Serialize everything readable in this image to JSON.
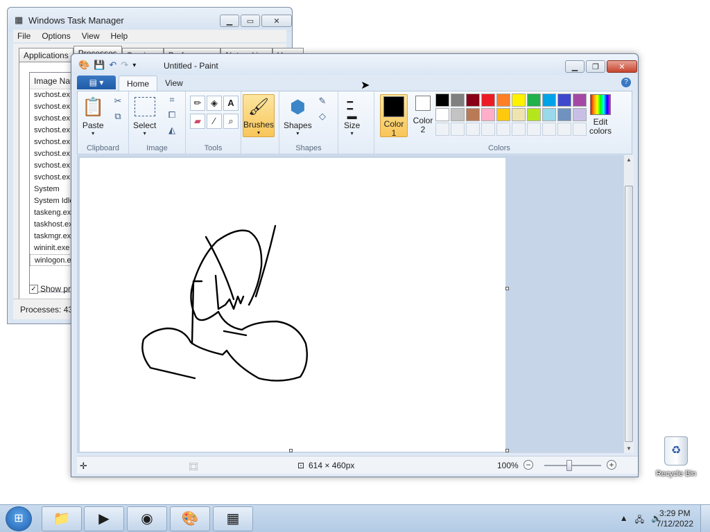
{
  "task_manager": {
    "title": "Windows Task Manager",
    "menu": [
      "File",
      "Options",
      "View",
      "Help"
    ],
    "tabs": [
      "Applications",
      "Processes",
      "Services",
      "Performance",
      "Networking",
      "Users"
    ],
    "column_header": "Image Nam",
    "processes": [
      "svchost.ex",
      "svchost.ex",
      "svchost.ex",
      "svchost.ex",
      "svchost.ex",
      "svchost.ex",
      "svchost.ex",
      "svchost.ex",
      "System",
      "System Idle",
      "taskeng.ex",
      "taskhost.ex",
      "taskmgr.ex",
      "wininit.exe",
      "winlogon.ex"
    ],
    "show_processes_label": "Show pro",
    "status": "Processes: 43"
  },
  "paint": {
    "title": "Untitled - Paint",
    "tabs": {
      "home": "Home",
      "view": "View"
    },
    "groups": {
      "clipboard": "Clipboard",
      "image": "Image",
      "tools": "Tools",
      "shapes": "Shapes",
      "colors": "Colors"
    },
    "buttons": {
      "paste": "Paste",
      "select": "Select",
      "brushes": "Brushes",
      "shapes": "Shapes",
      "size": "Size",
      "color1": "Color\n1",
      "color2": "Color\n2",
      "edit_colors": "Edit\ncolors"
    },
    "color1": "#000000",
    "color2": "#ffffff",
    "palette": [
      "#000000",
      "#7f7f7f",
      "#880015",
      "#ed1c24",
      "#ff7f27",
      "#fff200",
      "#22b14c",
      "#00a2e8",
      "#3f48cc",
      "#a349a4",
      "#ffffff",
      "#c3c3c3",
      "#b97a57",
      "#ffaec9",
      "#ffc90e",
      "#efe4b0",
      "#b5e61d",
      "#99d9ea",
      "#7092be",
      "#c8bfe7"
    ],
    "status": {
      "dimensions": "614 × 460px",
      "zoom": "100%"
    }
  },
  "desktop": {
    "recycle_bin_label": "Recycle Bin"
  },
  "taskbar": {
    "time": "3:29 PM",
    "date": "7/12/2022"
  }
}
